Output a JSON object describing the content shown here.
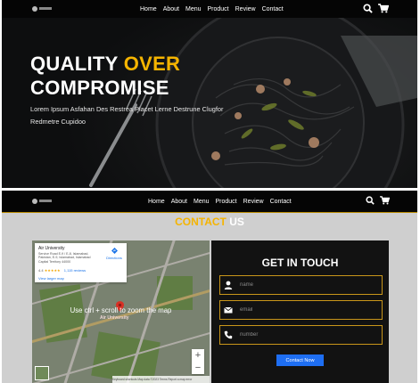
{
  "nav": {
    "links": [
      "Home",
      "About",
      "Menu",
      "Product",
      "Review",
      "Contact"
    ]
  },
  "hero": {
    "title_word1": "QUALITY",
    "title_word2": "OVER",
    "title_line2": "COMPROMISE",
    "subtitle": "Lorem Ipsum Asfahan Des Restrea Placet Lerne Destrune Clugfor Redmetre Cupidoo"
  },
  "icons": {
    "search": "search-icon",
    "cart": "cart-icon",
    "user": "user-icon",
    "email": "envelope-icon",
    "phone": "phone-icon",
    "map_pin": "map-pin-icon",
    "directions": "directions-icon"
  },
  "contact": {
    "heading_accent": "CONTACT",
    "heading_rest": "US",
    "form_title": "GET IN TOUCH",
    "name_placeholder": "name",
    "email_placeholder": "email",
    "number_placeholder": "number",
    "submit_label": "Contact Now"
  },
  "map": {
    "place_name": "Air University",
    "address": "Service Road E-9 / E-8, Islamabad, Pakistan, E-9, Islamabad, Islamabad Capital Territory 44000",
    "rating": "4.4",
    "stars": "★★★★★",
    "reviews": "1,115 reviews",
    "larger_map": "View larger map",
    "directions": "Directions",
    "overlay_message": "Use ctrl + scroll to zoom the map",
    "pin_label": "Air University",
    "zoom_in": "+",
    "zoom_out": "−",
    "footer": "Keyboard shortcuts   Map data ©2023   Terms   Report a map error"
  },
  "colors": {
    "accent": "#f5b400",
    "dark": "#121212",
    "button_blue": "#1e6ef2",
    "field_border": "#c9961a"
  }
}
